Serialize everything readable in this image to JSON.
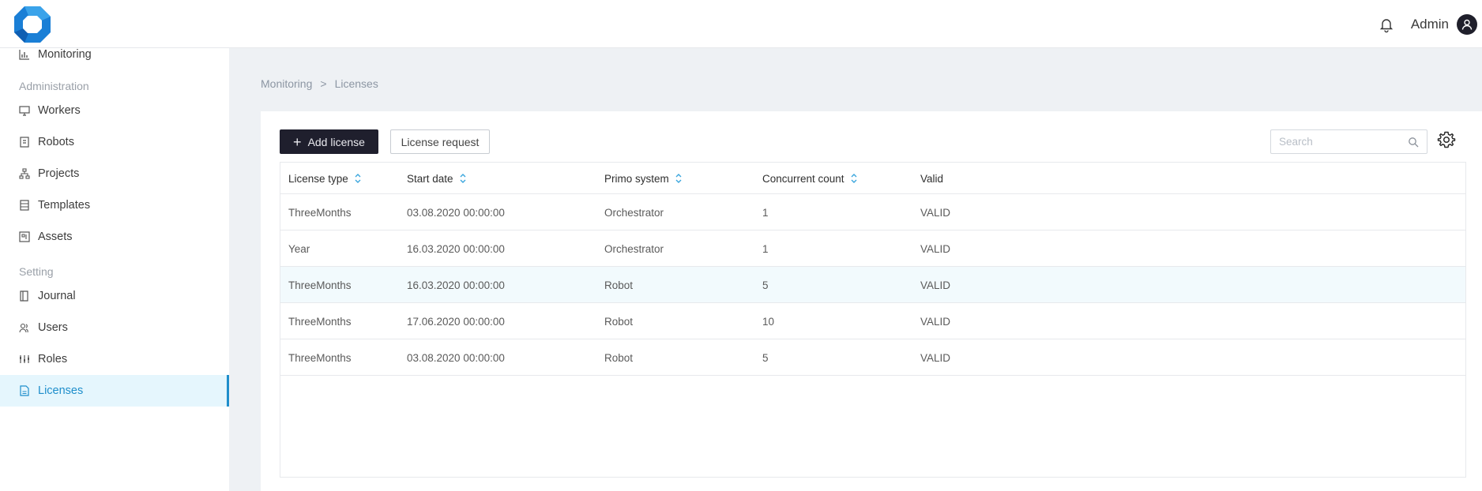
{
  "header": {
    "user_name": "Admin",
    "icons": {
      "logo": "octagon-logo",
      "bell": "bell-icon",
      "avatar": "user-avatar-icon"
    },
    "brand_color": "#1e8ecb"
  },
  "sidebar": {
    "items": [
      {
        "label": "Monitoring",
        "icon": "bar-chart-icon"
      },
      {
        "section": "Administration"
      },
      {
        "label": "Workers",
        "icon": "monitor-icon"
      },
      {
        "label": "Robots",
        "icon": "robot-icon"
      },
      {
        "label": "Projects",
        "icon": "hierarchy-icon"
      },
      {
        "label": "Templates",
        "icon": "list-icon"
      },
      {
        "label": "Assets",
        "icon": "assets-icon"
      },
      {
        "section": "Setting"
      },
      {
        "label": "Journal",
        "icon": "book-icon"
      },
      {
        "label": "Users",
        "icon": "users-icon"
      },
      {
        "label": "Roles",
        "icon": "roles-icon"
      },
      {
        "label": "Licenses",
        "icon": "document-icon",
        "active": true
      }
    ]
  },
  "breadcrumb": {
    "parent": "Monitoring",
    "separator": ">",
    "current": "Licenses"
  },
  "toolbar": {
    "add_label": "Add license",
    "request_label": "License request",
    "search_placeholder": "Search"
  },
  "table": {
    "columns": [
      {
        "label": "License type",
        "sortable": true
      },
      {
        "label": "Start date",
        "sortable": true
      },
      {
        "label": "Primo system",
        "sortable": true
      },
      {
        "label": "Concurrent count",
        "sortable": true
      },
      {
        "label": "Valid",
        "sortable": false
      }
    ],
    "rows": [
      [
        "ThreeMonths",
        "03.08.2020 00:00:00",
        "Orchestrator",
        "1",
        "VALID"
      ],
      [
        "Year",
        "16.03.2020 00:00:00",
        "Orchestrator",
        "1",
        "VALID"
      ],
      [
        "ThreeMonths",
        "16.03.2020 00:00:00",
        "Robot",
        "5",
        "VALID"
      ],
      [
        "ThreeMonths",
        "17.06.2020 00:00:00",
        "Robot",
        "10",
        "VALID"
      ],
      [
        "ThreeMonths",
        "03.08.2020 00:00:00",
        "Robot",
        "5",
        "VALID"
      ]
    ],
    "highlighted_row": 2
  }
}
